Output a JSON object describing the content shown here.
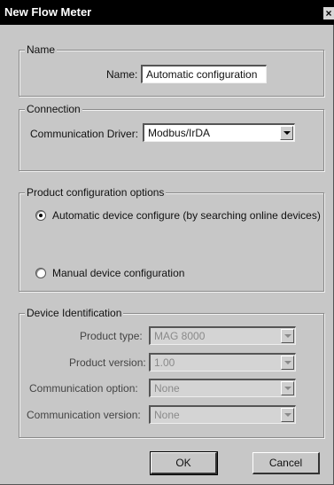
{
  "window": {
    "title": "New Flow Meter",
    "close_glyph": "×"
  },
  "name_group": {
    "legend": "Name",
    "label": "Name:",
    "value": "Automatic configuration"
  },
  "connection_group": {
    "legend": "Connection",
    "label": "Communication Driver:",
    "value": "Modbus/IrDA"
  },
  "product_config_group": {
    "legend": "Product configuration options",
    "options": [
      {
        "label": "Automatic device configure (by searching online devices)",
        "checked": true
      },
      {
        "label": "Manual device configuration",
        "checked": false
      }
    ]
  },
  "device_id_group": {
    "legend": "Device Identification",
    "fields": [
      {
        "label": "Product type:",
        "value": "MAG 8000"
      },
      {
        "label": "Product version:",
        "value": "1.00"
      },
      {
        "label": "Communication option:",
        "value": "None"
      },
      {
        "label": "Communication version:",
        "value": "None"
      }
    ]
  },
  "buttons": {
    "ok": "OK",
    "cancel": "Cancel"
  },
  "colors": {
    "titlebar": "#000000",
    "dialog_face": "#c7c7c7"
  }
}
